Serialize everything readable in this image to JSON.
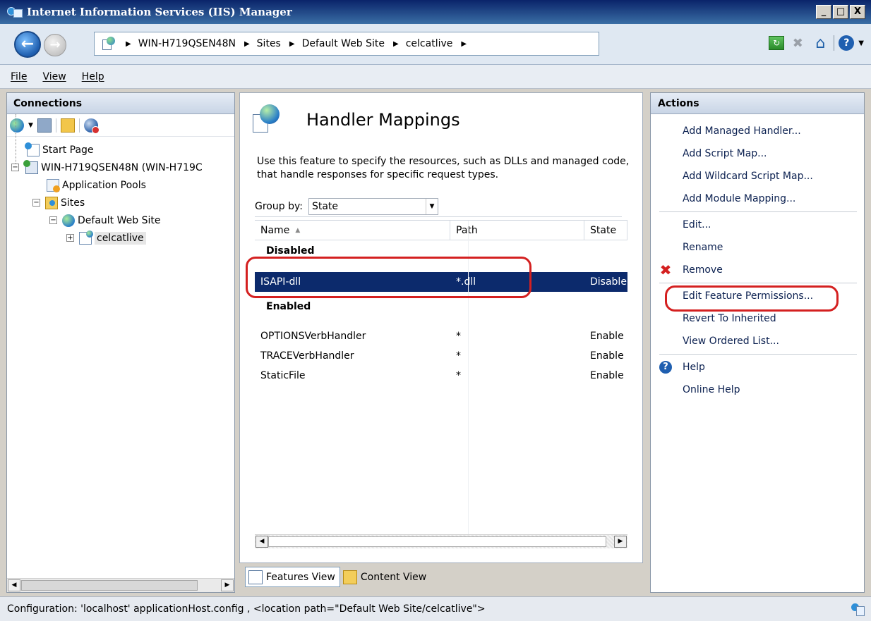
{
  "window": {
    "title": "Internet Information Services (IIS) Manager",
    "minimize": "_",
    "maximize": "□",
    "close": "X"
  },
  "address": {
    "crumbs": [
      "WIN-H719QSEN48N",
      "Sites",
      "Default Web Site",
      "celcatlive"
    ]
  },
  "menu": {
    "items": [
      "File",
      "View",
      "Help"
    ]
  },
  "connections": {
    "title": "Connections",
    "tree": {
      "start_page": "Start Page",
      "server": "WIN-H719QSEN48N (WIN-H719C",
      "app_pools": "Application Pools",
      "sites": "Sites",
      "default_site": "Default Web Site",
      "app": "celcatlive"
    }
  },
  "feature": {
    "title": "Handler Mappings",
    "description": "Use this feature to specify the resources, such as DLLs and managed code, that handle responses for specific request types.",
    "group_by_label": "Group by:",
    "group_by_value": "State",
    "columns": {
      "name": "Name",
      "path": "Path",
      "state": "State"
    },
    "groups": [
      {
        "label": "Disabled",
        "rows": [
          {
            "name": "ISAPI-dll",
            "path": "*.dll",
            "state": "Disable"
          }
        ]
      },
      {
        "label": "Enabled",
        "rows": [
          {
            "name": "OPTIONSVerbHandler",
            "path": "*",
            "state": "Enable"
          },
          {
            "name": "TRACEVerbHandler",
            "path": "*",
            "state": "Enable"
          },
          {
            "name": "StaticFile",
            "path": "*",
            "state": "Enable"
          }
        ]
      }
    ]
  },
  "views": {
    "features": "Features View",
    "content": "Content View"
  },
  "actions": {
    "title": "Actions",
    "add_managed": "Add Managed Handler...",
    "add_script": "Add Script Map...",
    "add_wildcard": "Add Wildcard Script Map...",
    "add_module": "Add Module Mapping...",
    "edit": "Edit...",
    "rename": "Rename",
    "remove": "Remove",
    "edit_perms": "Edit Feature Permissions...",
    "revert": "Revert To Inherited",
    "ordered": "View Ordered List...",
    "help": "Help",
    "online_help": "Online Help"
  },
  "status": {
    "text": "Configuration: 'localhost' applicationHost.config , <location path=\"Default Web Site/celcatlive\">"
  },
  "colors": {
    "selection": "#0c2a6c",
    "highlight": "#d42020",
    "title_bar": "#0a246a"
  }
}
